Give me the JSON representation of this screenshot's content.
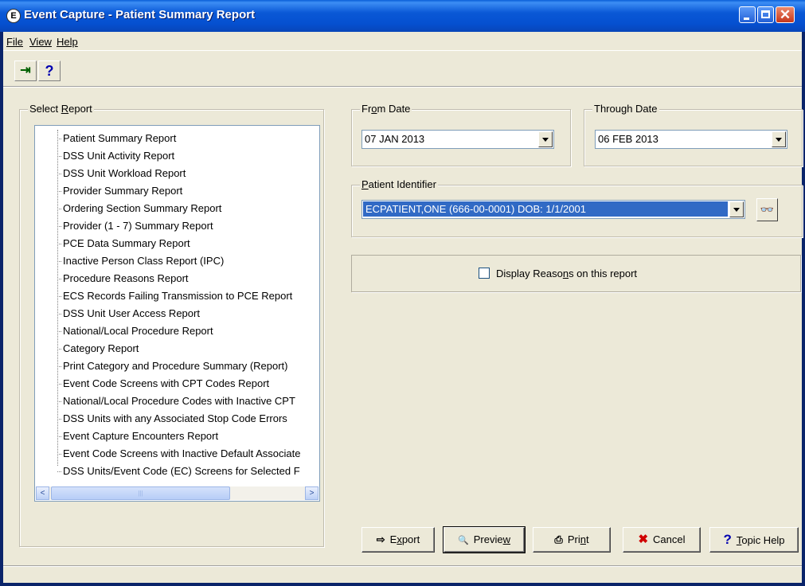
{
  "window": {
    "app_icon_glyph": "E",
    "title": "Event Capture - Patient Summary Report",
    "min_icon": "minimize-icon",
    "max_icon": "maximize-icon",
    "close_icon": "close-icon",
    "close_glyph": "✕"
  },
  "menu": [
    {
      "label": "File"
    },
    {
      "label": "View"
    },
    {
      "label": "Help"
    }
  ],
  "toolbar": {
    "exit_icon": "exit-door-icon",
    "exit_glyph": "⇥",
    "help_glyph": "?"
  },
  "select_report": {
    "label_pre": "Select ",
    "label_accel": "R",
    "label_post": "eport",
    "items": [
      "Patient Summary Report",
      "DSS Unit Activity Report",
      "DSS Unit Workload Report",
      "Provider Summary Report",
      "Ordering Section Summary Report",
      "Provider (1 - 7) Summary Report",
      "PCE Data Summary Report",
      "Inactive Person Class Report (IPC)",
      "Procedure Reasons Report",
      "ECS Records Failing Transmission to PCE Report",
      "DSS Unit User Access Report",
      "National/Local Procedure Report",
      "Category Report",
      "Print Category and Procedure Summary (Report)",
      "Event Code Screens with CPT Codes Report",
      "National/Local Procedure Codes with Inactive CPT",
      "DSS Units with any Associated Stop Code Errors",
      "Event Capture Encounters Report",
      "Event Code Screens with Inactive Default Associate",
      "DSS Units/Event Code (EC) Screens for Selected F"
    ],
    "scroll_left_glyph": "<",
    "scroll_right_glyph": ">",
    "scroll_grip": "|||"
  },
  "from_date": {
    "label_pre": "Fr",
    "label_accel": "o",
    "label_post": "m Date",
    "value": "07 JAN 2013"
  },
  "through_date": {
    "label_pre": "Throu",
    "label_accel": "g",
    "label_post": "h Date",
    "value": "06 FEB 2013"
  },
  "patient": {
    "label_pre": "",
    "label_accel": "P",
    "label_post": "atient Identifier",
    "value": "ECPATIENT,ONE  (666-00-0001)  DOB: 1/1/2001",
    "find_icon": "binoculars-icon",
    "find_glyph": "👓"
  },
  "options": {
    "display_reasons_pre": "Display Reaso",
    "display_reasons_accel": "n",
    "display_reasons_post": "s on this report",
    "display_reasons_checked": false
  },
  "buttons": {
    "export": {
      "pre": "E",
      "accel": "x",
      "post": "port",
      "glyph": "⇨"
    },
    "preview": {
      "pre": "Previe",
      "accel": "w",
      "post": "",
      "glyph": "🔍"
    },
    "print": {
      "pre": "Pri",
      "accel": "n",
      "post": "t",
      "glyph": "⎙"
    },
    "cancel": {
      "label": "Cancel",
      "glyph": "✖"
    },
    "topic_help": {
      "pre": "",
      "accel": "T",
      "post": "opic Help",
      "glyph": "?"
    }
  },
  "colors": {
    "title_bar": "#0a58d6",
    "selection": "#316ac5",
    "face": "#ece9d8",
    "cancel_red": "#d00000",
    "help_blue": "#0000b0"
  }
}
